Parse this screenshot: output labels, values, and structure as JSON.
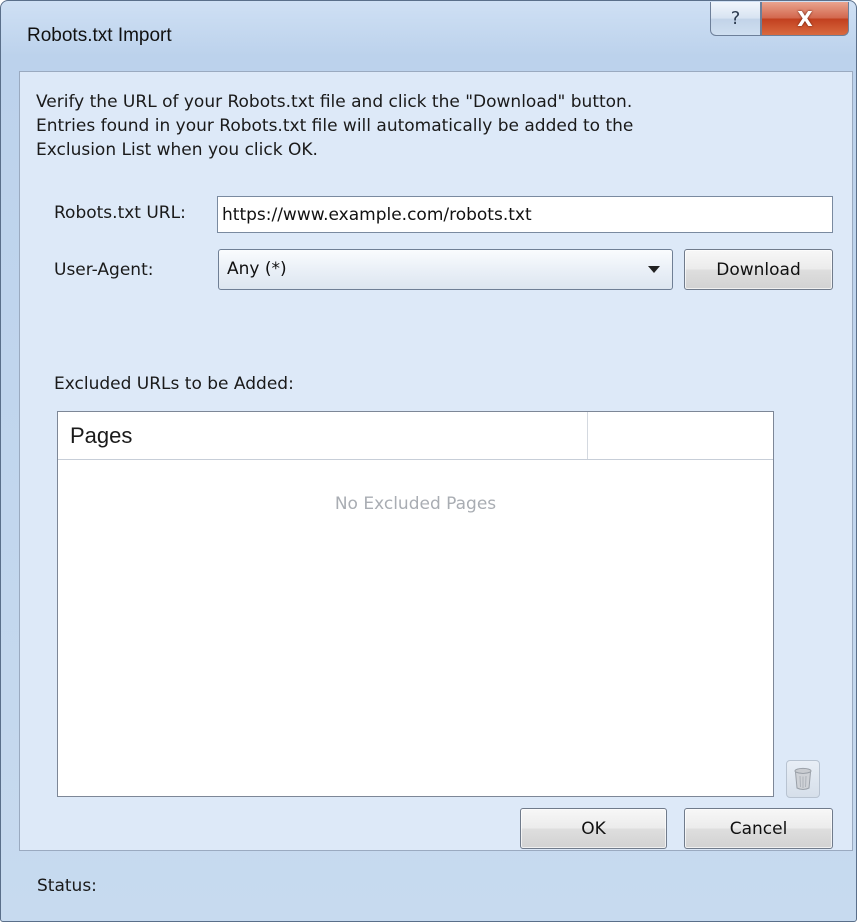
{
  "window": {
    "title": "Robots.txt Import",
    "help_glyph": "?",
    "close_glyph": "X"
  },
  "description": "Verify the URL of your Robots.txt file and click the \"Download\" button.\nEntries found in your Robots.txt file will automatically be added to the\nExclusion List when you click OK.",
  "url_field": {
    "label": "Robots.txt URL:",
    "value": "https://www.example.com/robots.txt"
  },
  "user_agent": {
    "label": "User-Agent:",
    "selected": "Any (*)"
  },
  "download_label": "Download",
  "excluded": {
    "label": "Excluded URLs to be Added:",
    "column_pages": "Pages",
    "empty_text": "No Excluded Pages"
  },
  "buttons": {
    "ok": "OK",
    "cancel": "Cancel"
  },
  "status": {
    "label": "Status:"
  },
  "icons": [
    "help-icon",
    "close-icon",
    "dropdown-arrow-icon",
    "trash-icon"
  ]
}
